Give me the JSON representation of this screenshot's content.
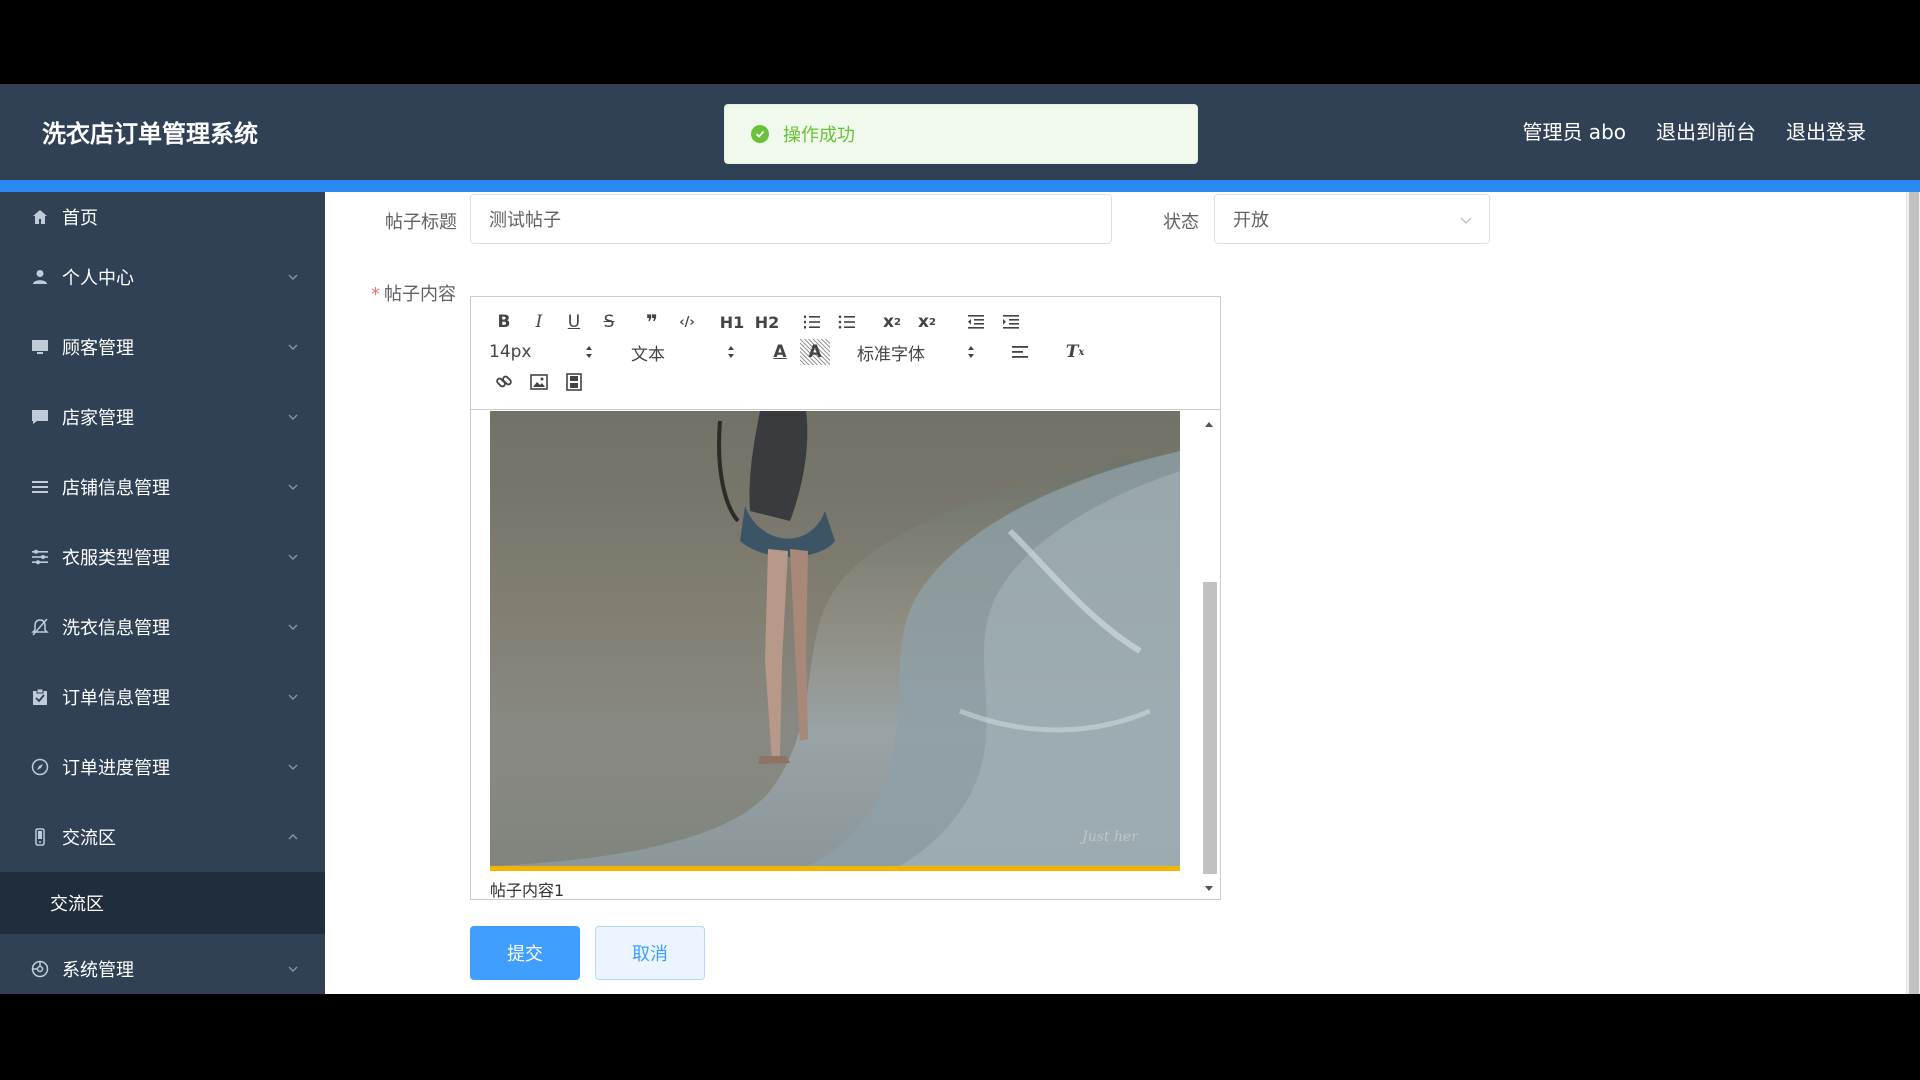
{
  "header": {
    "app_title": "洗衣店订单管理系统",
    "user_label": "管理员 abo",
    "to_front": "退出到前台",
    "logout": "退出登录"
  },
  "toast": {
    "message": "操作成功",
    "color": "#67c23a"
  },
  "colors": {
    "sidebar_bg": "#304156",
    "accent": "#2a89f0",
    "primary": "#409eff"
  },
  "sidebar": {
    "items": [
      {
        "label": "首页",
        "icon": "home-icon"
      },
      {
        "label": "个人中心",
        "icon": "user-icon"
      },
      {
        "label": "顾客管理",
        "icon": "monitor-icon"
      },
      {
        "label": "店家管理",
        "icon": "chat-icon"
      },
      {
        "label": "店铺信息管理",
        "icon": "list-icon"
      },
      {
        "label": "衣服类型管理",
        "icon": "sliders-icon"
      },
      {
        "label": "洗衣信息管理",
        "icon": "bell-off-icon"
      },
      {
        "label": "订单信息管理",
        "icon": "clipboard-check-icon"
      },
      {
        "label": "订单进度管理",
        "icon": "compass-icon"
      },
      {
        "label": "交流区",
        "icon": "phone-icon",
        "expanded": true
      },
      {
        "label": "系统管理",
        "icon": "settings-circle-icon"
      }
    ],
    "sub_items": [
      {
        "label": "交流区"
      }
    ]
  },
  "form": {
    "title_label": "帖子标题",
    "title_value": "测试帖子",
    "status_label": "状态",
    "status_value": "开放",
    "content_label": "帖子内容",
    "required_mark": "*"
  },
  "editor": {
    "font_size": "14px",
    "header_select": "文本",
    "font_family": "标准字体",
    "h1": "H1",
    "h2": "H2",
    "content_text": "帖子内容1",
    "image_watermark": "Just her"
  },
  "buttons": {
    "submit": "提交",
    "cancel": "取消"
  }
}
